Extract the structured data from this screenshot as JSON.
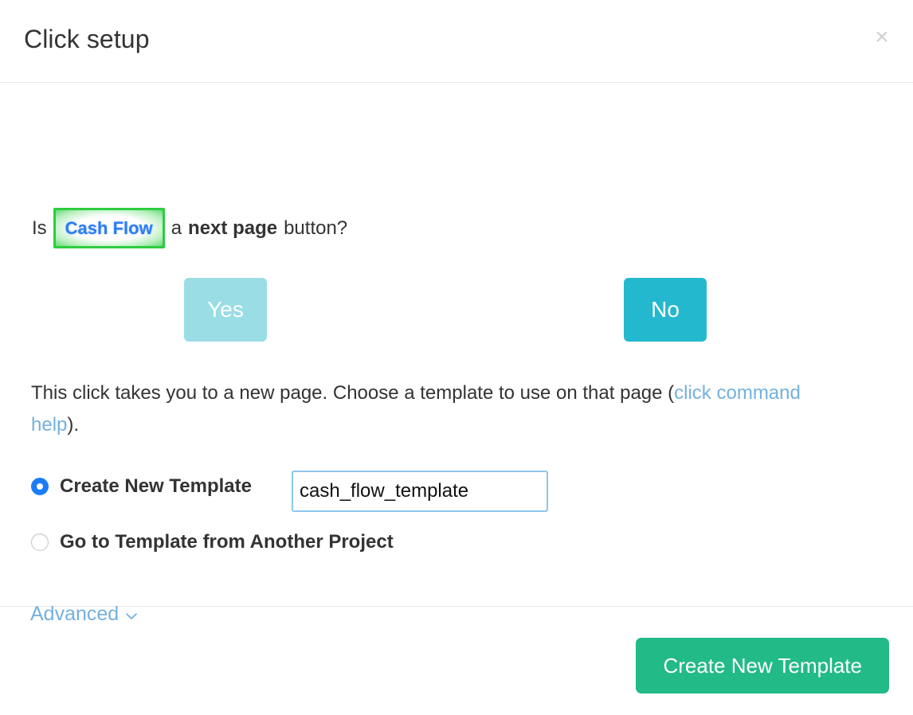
{
  "dialog": {
    "title": "Click setup",
    "close_label": "×",
    "close_icon": "close-icon"
  },
  "question": {
    "prefix": "Is",
    "target_label": "Cash Flow",
    "middle": "a",
    "emphasis": "next page",
    "suffix": "button?",
    "highlight_border_color": "#2ecc40",
    "target_text_color": "#2b7cf6"
  },
  "answers": {
    "yes_label": "Yes",
    "no_label": "No",
    "yes_color": "#9adde5",
    "no_color": "#23b8cd",
    "selected": "No"
  },
  "info": {
    "text_before": "This click takes you to a new page. Choose a template to use on that page (",
    "link_label": "click command help",
    "text_after": ").",
    "link_color": "#74b1dd"
  },
  "options": {
    "items": [
      {
        "label": "Create New Template",
        "checked": true
      },
      {
        "label": "Go to Template from Another Project",
        "checked": false
      }
    ]
  },
  "template_input": {
    "value": "cash_flow_template",
    "placeholder": "",
    "focus_border_color": "#8cc6ec"
  },
  "advanced": {
    "label": "Advanced",
    "chevron_icon": "chevron-down-icon",
    "expanded": false
  },
  "footer": {
    "primary_label": "Create New Template",
    "primary_color": "#22ba86"
  }
}
